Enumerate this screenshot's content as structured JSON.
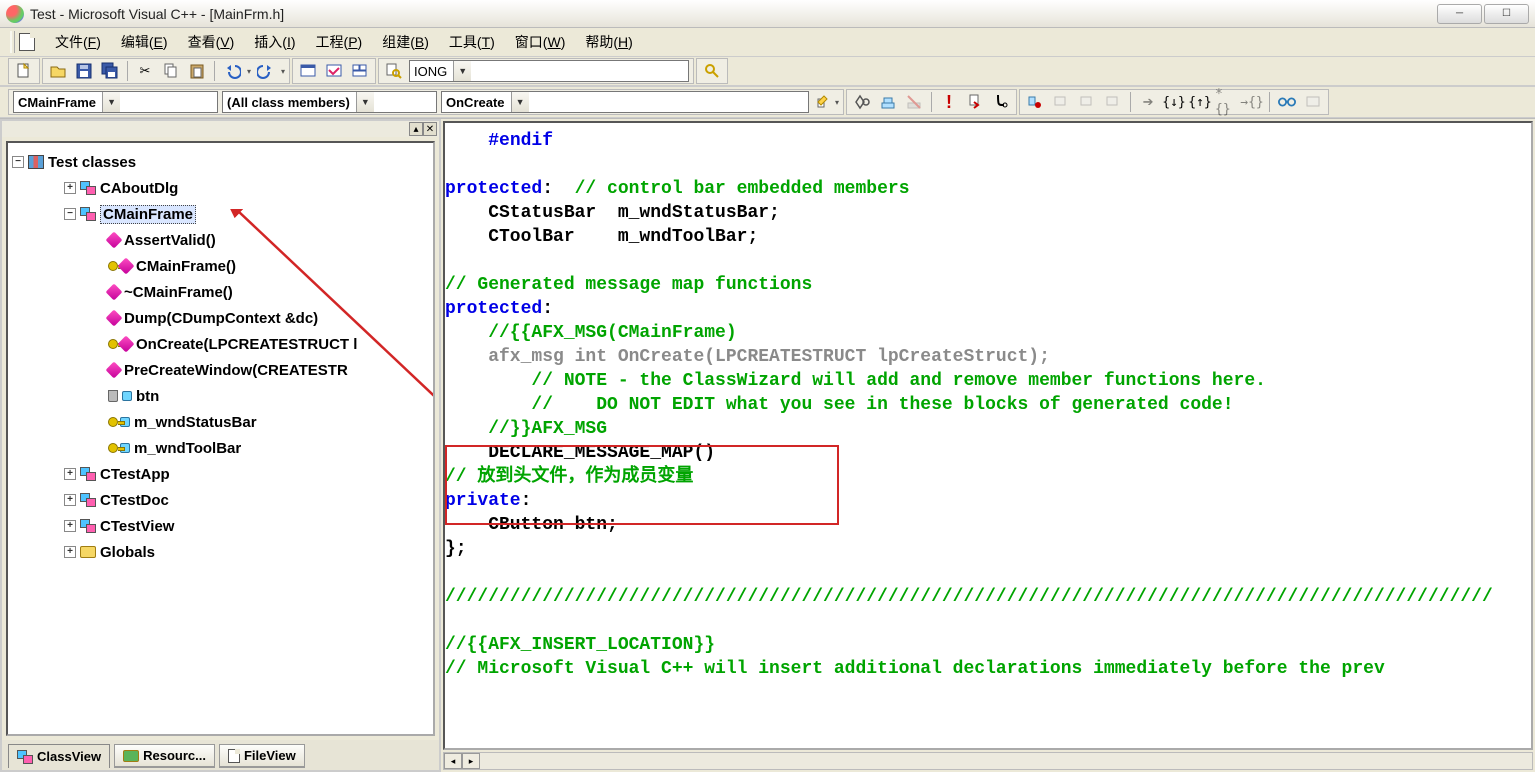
{
  "title": "Test - Microsoft Visual C++ - [MainFrm.h]",
  "menu": {
    "file": {
      "label": "文件",
      "key": "F"
    },
    "edit": {
      "label": "编辑",
      "key": "E"
    },
    "view": {
      "label": "查看",
      "key": "V"
    },
    "insert": {
      "label": "插入",
      "key": "I"
    },
    "project": {
      "label": "工程",
      "key": "P"
    },
    "build": {
      "label": "组建",
      "key": "B"
    },
    "tools": {
      "label": "工具",
      "key": "T"
    },
    "window": {
      "label": "窗口",
      "key": "W"
    },
    "help": {
      "label": "帮助",
      "key": "H"
    }
  },
  "dropdowns": {
    "class": "CMainFrame",
    "filter": "(All class members)",
    "member": "OnCreate",
    "find": "IONG"
  },
  "tree": {
    "root": "Test classes",
    "items": [
      {
        "icon": "cls",
        "label": "CAboutDlg",
        "expand": "+",
        "indent": 1
      },
      {
        "icon": "cls",
        "label": "CMainFrame",
        "expand": "-",
        "indent": 1,
        "sel": true
      },
      {
        "icon": "fn",
        "label": "AssertValid()",
        "indent": 2
      },
      {
        "icon": "keyfn",
        "label": "CMainFrame()",
        "indent": 2
      },
      {
        "icon": "fn",
        "label": "~CMainFrame()",
        "indent": 2
      },
      {
        "icon": "fn",
        "label": "Dump(CDumpContext &dc)",
        "indent": 2
      },
      {
        "icon": "keyfn",
        "label": "OnCreate(LPCREATESTRUCT l",
        "indent": 2
      },
      {
        "icon": "fn",
        "label": "PreCreateWindow(CREATESTR",
        "indent": 2,
        "trunc": true
      },
      {
        "icon": "lockvar",
        "label": "btn",
        "indent": 2
      },
      {
        "icon": "keyvar",
        "label": "m_wndStatusBar",
        "indent": 2
      },
      {
        "icon": "keyvar",
        "label": "m_wndToolBar",
        "indent": 2
      },
      {
        "icon": "cls",
        "label": "CTestApp",
        "expand": "+",
        "indent": 1
      },
      {
        "icon": "cls",
        "label": "CTestDoc",
        "expand": "+",
        "indent": 1
      },
      {
        "icon": "cls",
        "label": "CTestView",
        "expand": "+",
        "indent": 1
      },
      {
        "icon": "folder",
        "label": "Globals",
        "expand": "+",
        "indent": 1
      }
    ]
  },
  "tabs": {
    "classview": "ClassView",
    "resourceview": "Resourc...",
    "fileview": "FileView"
  },
  "code": {
    "l01": "#endif",
    "l03a": "protected",
    "l03b": ":",
    "l03c": "  // control bar embedded members",
    "l04": "    CStatusBar  m_wndStatusBar;",
    "l05": "    CToolBar    m_wndToolBar;",
    "l07": "// Generated message map functions",
    "l08a": "protected",
    "l08b": ":",
    "l09": "    //{{AFX_MSG(CMainFrame)",
    "l10": "    afx_msg int OnCreate(LPCREATESTRUCT lpCreateStruct);",
    "l11": "        // NOTE - the ClassWizard will add and remove member functions here.",
    "l12": "        //    DO NOT EDIT what you see in these blocks of generated code!",
    "l13": "    //}}AFX_MSG",
    "l14": "    DECLARE_MESSAGE_MAP()",
    "l15": "// 放到头文件，作为成员变量",
    "l16a": "private",
    "l16b": ":",
    "l17": "    CButton btn;",
    "l18": "};",
    "l20": "/////////////////////////////////////////////////////////////////////////////////////////////////",
    "l22": "//{{AFX_INSERT_LOCATION}}",
    "l23": "// Microsoft Visual C++ will insert additional declarations immediately before the prev"
  }
}
